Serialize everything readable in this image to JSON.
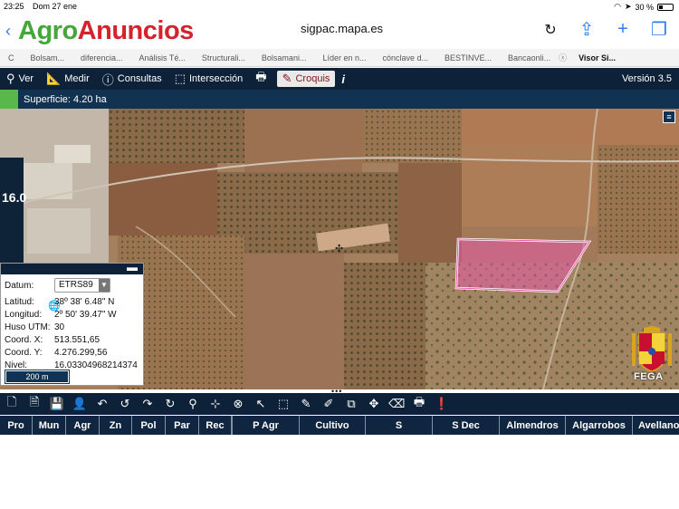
{
  "status_bar": {
    "time": "23:25",
    "date": "Dom 27 ene",
    "battery": "30 %"
  },
  "browser": {
    "logo_part1": "Agro",
    "logo_part2": "Anuncios",
    "url": "sigpac.mapa.es",
    "tabs": [
      {
        "label": "C",
        "active": false
      },
      {
        "label": "Bolsam...",
        "active": false
      },
      {
        "label": "diferencia...",
        "active": false
      },
      {
        "label": "Análisis Té...",
        "active": false
      },
      {
        "label": "Structurali...",
        "active": false
      },
      {
        "label": "Bolsamani...",
        "active": false
      },
      {
        "label": "Líder en n...",
        "active": false
      },
      {
        "label": "cónclave d...",
        "active": false
      },
      {
        "label": "BESTINVE...",
        "active": false
      },
      {
        "label": "Bancaonli...",
        "active": false
      },
      {
        "label": "Visor Si...",
        "active": true
      }
    ]
  },
  "toolbar": {
    "ver": "Ver",
    "medir": "Medir",
    "consultas": "Consultas",
    "interseccion": "Intersección",
    "croquis": "Croquis",
    "version": "Versión 3.5"
  },
  "surface": {
    "label": "Superficie: 4.20 ha"
  },
  "level_value": "16.0",
  "info": {
    "datum_label": "Datum:",
    "datum_value": "ETRS89",
    "latitud_label": "Latitud:",
    "latitud_value": "38º 38' 6.48\" N",
    "longitud_label": "Longitud:",
    "longitud_value": "2º 50' 39.47\" W",
    "huso_label": "Huso UTM:",
    "huso_value": "30",
    "coordx_label": "Coord. X:",
    "coordx_value": "513.551,65",
    "coordy_label": "Coord. Y:",
    "coordy_value": "4.276.299,56",
    "nivel_label": "Nivel:",
    "nivel_value": "16.03304968214374",
    "scale": "200 m"
  },
  "fega_label": "FEGA",
  "grid_columns": [
    "Pro",
    "Mun",
    "Agr",
    "Zn",
    "Pol",
    "Par",
    "Rec",
    "P Agr",
    "Cultivo",
    "S",
    "S Dec",
    "Almendros",
    "Algarrobos",
    "Avellano"
  ],
  "colors": {
    "toolbar_bg": "#0d2238",
    "parcel_fill": "#e85aa8",
    "accent_green": "#58b84a"
  }
}
